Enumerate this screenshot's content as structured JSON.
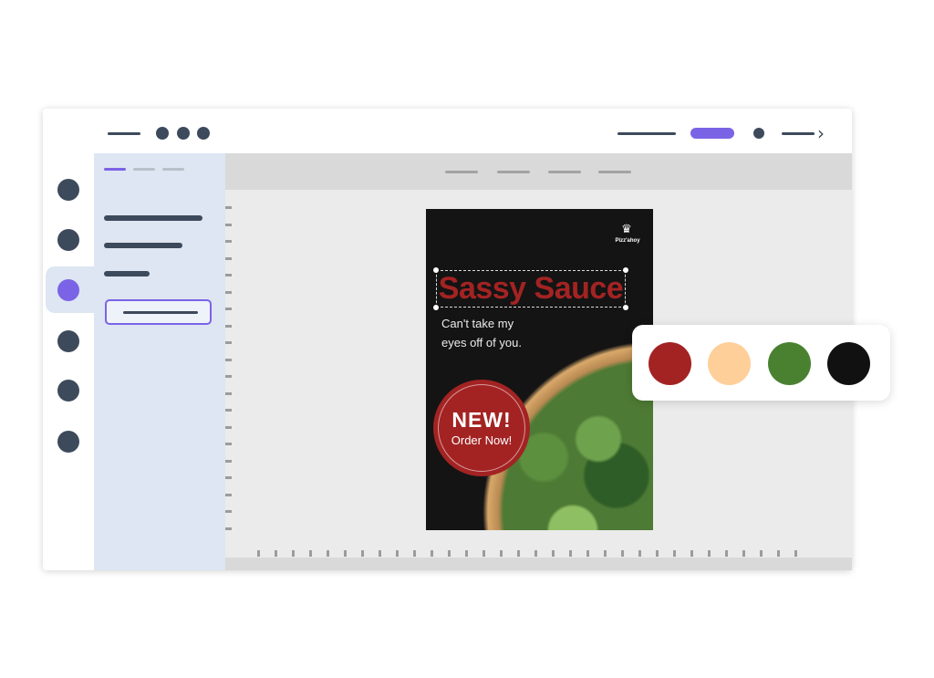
{
  "poster": {
    "logo_text": "Pizz'ahoy",
    "headline": "Sassy Sauce",
    "tagline_line1": "Can't take my",
    "tagline_line2": "eyes off of you.",
    "badge_title": "NEW!",
    "badge_action": "Order Now!"
  },
  "palette": {
    "swatches": [
      "#a32323",
      "#ffcf99",
      "#4a8131",
      "#111111"
    ]
  },
  "colors": {
    "accent": "#7b63e6",
    "rail_icon": "#3d4a5c",
    "panel_bg": "#dde6f2",
    "canvas_bg": "#ebebeb"
  },
  "icons": {
    "chef_hat": "chef-hat-icon",
    "forward": "chevron-right-icon"
  }
}
